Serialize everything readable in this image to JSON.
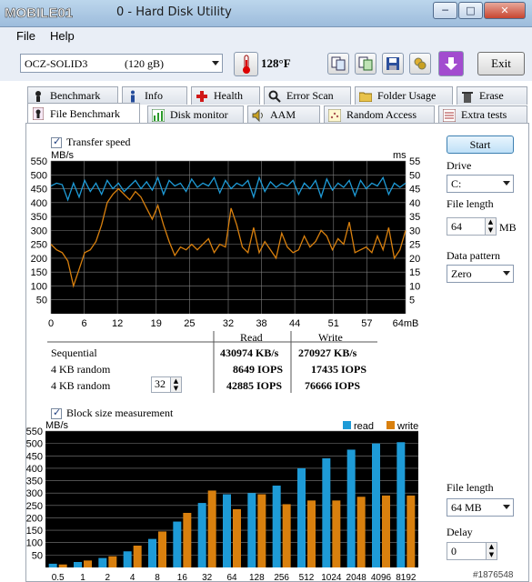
{
  "window": {
    "title": "0 - Hard Disk Utility",
    "logo": "MOBILE01",
    "buttons": {
      "minimize": "─",
      "maximize": "□",
      "close": "✕"
    }
  },
  "menu": {
    "file": "File",
    "help": "Help"
  },
  "toolbar": {
    "drive": "OCZ-SOLID3",
    "drive_size": "(120 gB)",
    "temperature": "128°F",
    "exit": "Exit"
  },
  "tabs": {
    "row1": [
      "Benchmark",
      "Info",
      "Health",
      "Error Scan",
      "Folder Usage",
      "Erase"
    ],
    "row2": [
      "File Benchmark",
      "Disk monitor",
      "AAM",
      "Random Access",
      "Extra tests"
    ]
  },
  "transfer": {
    "checkbox_label": "Transfer speed",
    "unit_left": "MB/s",
    "unit_right": "ms"
  },
  "results": {
    "read_header": "Read",
    "write_header": "Write",
    "rows": [
      {
        "label": "Sequential",
        "read": "430974 KB/s",
        "write": "270927 KB/s"
      },
      {
        "label": "4 KB random",
        "read": "8649 IOPS",
        "write": "17435 IOPS"
      },
      {
        "label": "4 KB random",
        "read": "42885 IOPS",
        "write": "76666 IOPS"
      }
    ],
    "queue_depth": "32"
  },
  "block": {
    "checkbox_label": "Block size measurement",
    "unit": "MB/s",
    "legend_read": "read",
    "legend_write": "write"
  },
  "side": {
    "start": "Start",
    "drive_label": "Drive",
    "drive_value": "C:",
    "file_length_label": "File length",
    "file_length_value": "64",
    "file_length_unit": "MB",
    "data_pattern_label": "Data pattern",
    "data_pattern_value": "Zero",
    "file_length2_label": "File length",
    "file_length2_value": "64 MB",
    "delay_label": "Delay",
    "delay_value": "0"
  },
  "watermark": "#1876548",
  "colors": {
    "read": "#1e9bd7",
    "write": "#d9800e",
    "grid": "#7f7f7f",
    "plot_bg": "#000000"
  },
  "chart_data": [
    {
      "type": "line",
      "x_ticks": [
        "0",
        "6",
        "12",
        "19",
        "25",
        "32",
        "38",
        "44",
        "51",
        "57",
        "64mB"
      ],
      "y_ticks_left": [
        "50",
        "100",
        "150",
        "200",
        "250",
        "300",
        "350",
        "400",
        "450",
        "500",
        "550"
      ],
      "y_ticks_right": [
        "5",
        "10",
        "15",
        "20",
        "25",
        "30",
        "35",
        "40",
        "45",
        "50",
        "55"
      ],
      "ylabel_left": "MB/s",
      "ylabel_right": "ms",
      "xlim": [
        0,
        64
      ],
      "ylim": [
        0,
        550
      ],
      "y2lim": [
        0,
        55
      ],
      "series": [
        {
          "axis": "left",
          "values": [
            460,
            470,
            465,
            410,
            470,
            420,
            480,
            440,
            470,
            430,
            480,
            450,
            470,
            440,
            460,
            480,
            450,
            475,
            445,
            490,
            430,
            480,
            460,
            470,
            440,
            485,
            455,
            470,
            460,
            490,
            435,
            480,
            450,
            470,
            460,
            480,
            420,
            490,
            440,
            475,
            455,
            470,
            460,
            480,
            430,
            470,
            450,
            480,
            420,
            485,
            445,
            470,
            455,
            480,
            425,
            480,
            450,
            470,
            460,
            490,
            430,
            470,
            455,
            470
          ]
        },
        {
          "axis": "right",
          "values": [
            25,
            23,
            22,
            19,
            10,
            16,
            22,
            23,
            26,
            32,
            40,
            43,
            45,
            43,
            41,
            44,
            42,
            38,
            34,
            39,
            32,
            26,
            21,
            24,
            23,
            25,
            23,
            25,
            27,
            22,
            25,
            24,
            38,
            32,
            24,
            22,
            31,
            22,
            26,
            23,
            20,
            29,
            24,
            22,
            23,
            28,
            24,
            26,
            30,
            28,
            23,
            27,
            25,
            33,
            22,
            23,
            24,
            22,
            28,
            23,
            31,
            20,
            23,
            30
          ]
        }
      ]
    },
    {
      "type": "bar",
      "categories": [
        "0.5",
        "1",
        "2",
        "4",
        "8",
        "16",
        "32",
        "64",
        "128",
        "256",
        "512",
        "1024",
        "2048",
        "4096",
        "8192"
      ],
      "y_ticks": [
        "50",
        "100",
        "150",
        "200",
        "250",
        "300",
        "350",
        "400",
        "450",
        "500",
        "550"
      ],
      "ylabel": "MB/s",
      "ylim": [
        0,
        550
      ],
      "series": [
        {
          "name": "read",
          "values": [
            15,
            22,
            38,
            65,
            115,
            185,
            260,
            295,
            300,
            330,
            400,
            440,
            475,
            500,
            505
          ]
        },
        {
          "name": "write",
          "values": [
            12,
            28,
            45,
            88,
            145,
            220,
            310,
            235,
            295,
            255,
            270,
            270,
            285,
            290,
            290
          ]
        }
      ]
    }
  ]
}
